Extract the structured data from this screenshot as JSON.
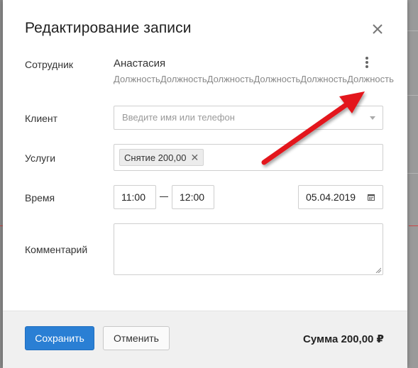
{
  "dialog": {
    "title": "Редактирование записи",
    "close_icon": "close-icon"
  },
  "employee": {
    "label": "Сотрудник",
    "name": "Анастасия",
    "position": "ДолжностьДолжностьДолжностьДолжностьДолжностьДолжность",
    "menu_icon": "kebab-menu-icon"
  },
  "client": {
    "label": "Клиент",
    "placeholder": "Введите имя или телефон",
    "value": ""
  },
  "services": {
    "label": "Услуги",
    "items": [
      {
        "label": "Снятие 200,00",
        "remove": "✕"
      }
    ]
  },
  "time": {
    "label": "Время",
    "start": "11:00",
    "end": "12:00",
    "date": "05.04.2019",
    "date_icon": "calendar-icon"
  },
  "comment": {
    "label": "Комментарий",
    "value": ""
  },
  "footer": {
    "save_label": "Сохранить",
    "cancel_label": "Отменить",
    "total": "Сумма 200,00 ₽"
  },
  "colors": {
    "primary": "#2a7fd4",
    "annotation_arrow": "#e3131b"
  }
}
